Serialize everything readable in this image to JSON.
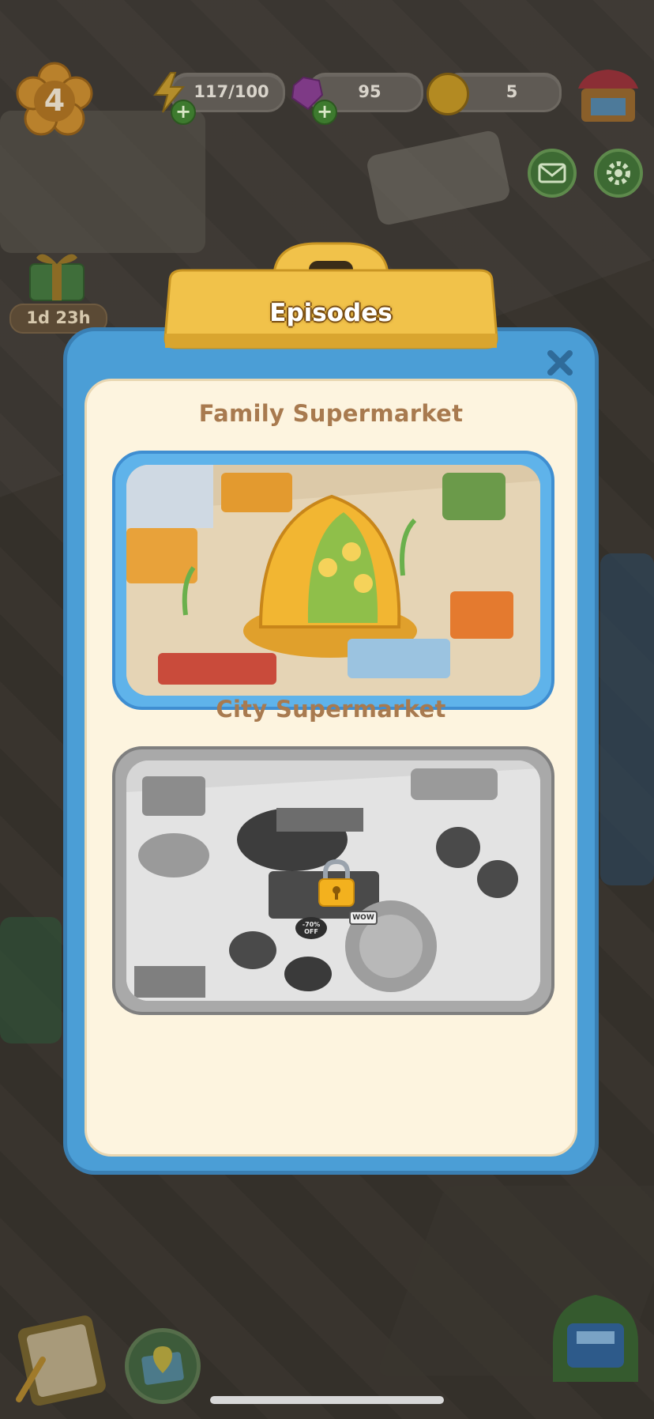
{
  "hud": {
    "level": "4",
    "energy": "117/100",
    "gems": "95",
    "coins": "5"
  },
  "gift": {
    "timer": "1d 23h"
  },
  "dialog": {
    "title": "Episodes",
    "episodes": [
      {
        "name": "Family Supermarket",
        "locked": false
      },
      {
        "name": "City Supermarket",
        "locked": true
      }
    ],
    "locked_sign": {
      "discount": "-70% OFF",
      "tag": "WOW"
    }
  },
  "colors": {
    "panel_blue": "#4b9ed6",
    "panel_cream": "#fdf4df",
    "title_brown": "#a87a4f",
    "clip_yellow": "#f1c24a"
  }
}
